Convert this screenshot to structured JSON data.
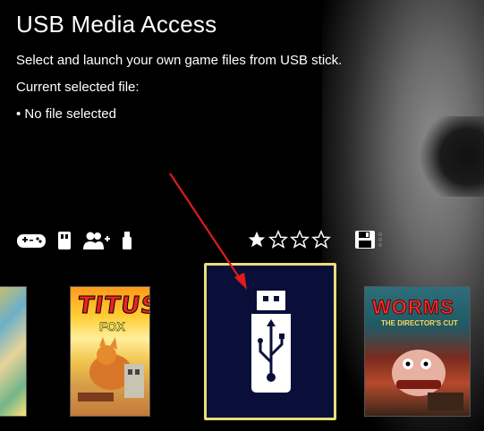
{
  "header": {
    "title": "USB Media Access",
    "description": "Select and launch your own game files from USB stick.",
    "current_label": "Current selected file:",
    "current_value": "• No file selected"
  },
  "icons": {
    "gamepad": "gamepad-icon",
    "memory_card": "memory-card-icon",
    "multiplayer": "multiplayer-icon",
    "usb_small": "usb-stick-icon",
    "save": "save-icon"
  },
  "rating": {
    "filled": 1,
    "total": 4
  },
  "carousel": {
    "items": [
      {
        "id": "left-partial"
      },
      {
        "title": "TITUS",
        "subtitle": "FOX"
      },
      {
        "type": "usb"
      },
      {
        "title": "WORMS",
        "subtitle": "THE DIRECTOR'S CUT"
      }
    ]
  },
  "colors": {
    "selected_border": "#e8dd7a",
    "selected_bg": "#0a0f3a",
    "arrow": "#e11b1b"
  }
}
